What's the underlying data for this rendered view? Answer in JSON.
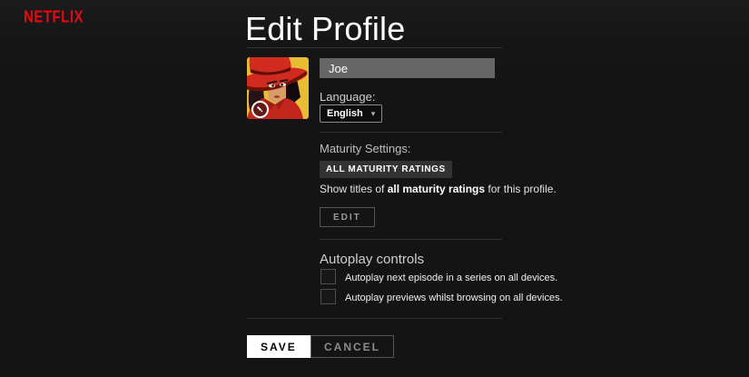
{
  "brand": {
    "logo_text": "NETFLIX",
    "logo_color": "#e50914"
  },
  "page": {
    "title": "Edit Profile"
  },
  "profile": {
    "name_value": "Joe",
    "avatar": "carmen-sandiego-avatar",
    "language_label": "Language:",
    "language_selected": "English"
  },
  "maturity": {
    "label": "Maturity Settings:",
    "badge": "ALL MATURITY RATINGS",
    "description_prefix": "Show titles of ",
    "description_bold": "all maturity ratings",
    "description_suffix": " for this profile.",
    "edit_button": "EDIT"
  },
  "autoplay": {
    "heading": "Autoplay controls",
    "options": [
      {
        "label": "Autoplay next episode in a series on all devices.",
        "checked": false
      },
      {
        "label": "Autoplay previews whilst browsing on all devices.",
        "checked": false
      }
    ]
  },
  "actions": {
    "save": "SAVE",
    "cancel": "CANCEL"
  },
  "colors": {
    "background": "#141414",
    "accent": "#e50914",
    "input_bg": "#666666",
    "badge_bg": "#333333",
    "divider": "#333333"
  }
}
